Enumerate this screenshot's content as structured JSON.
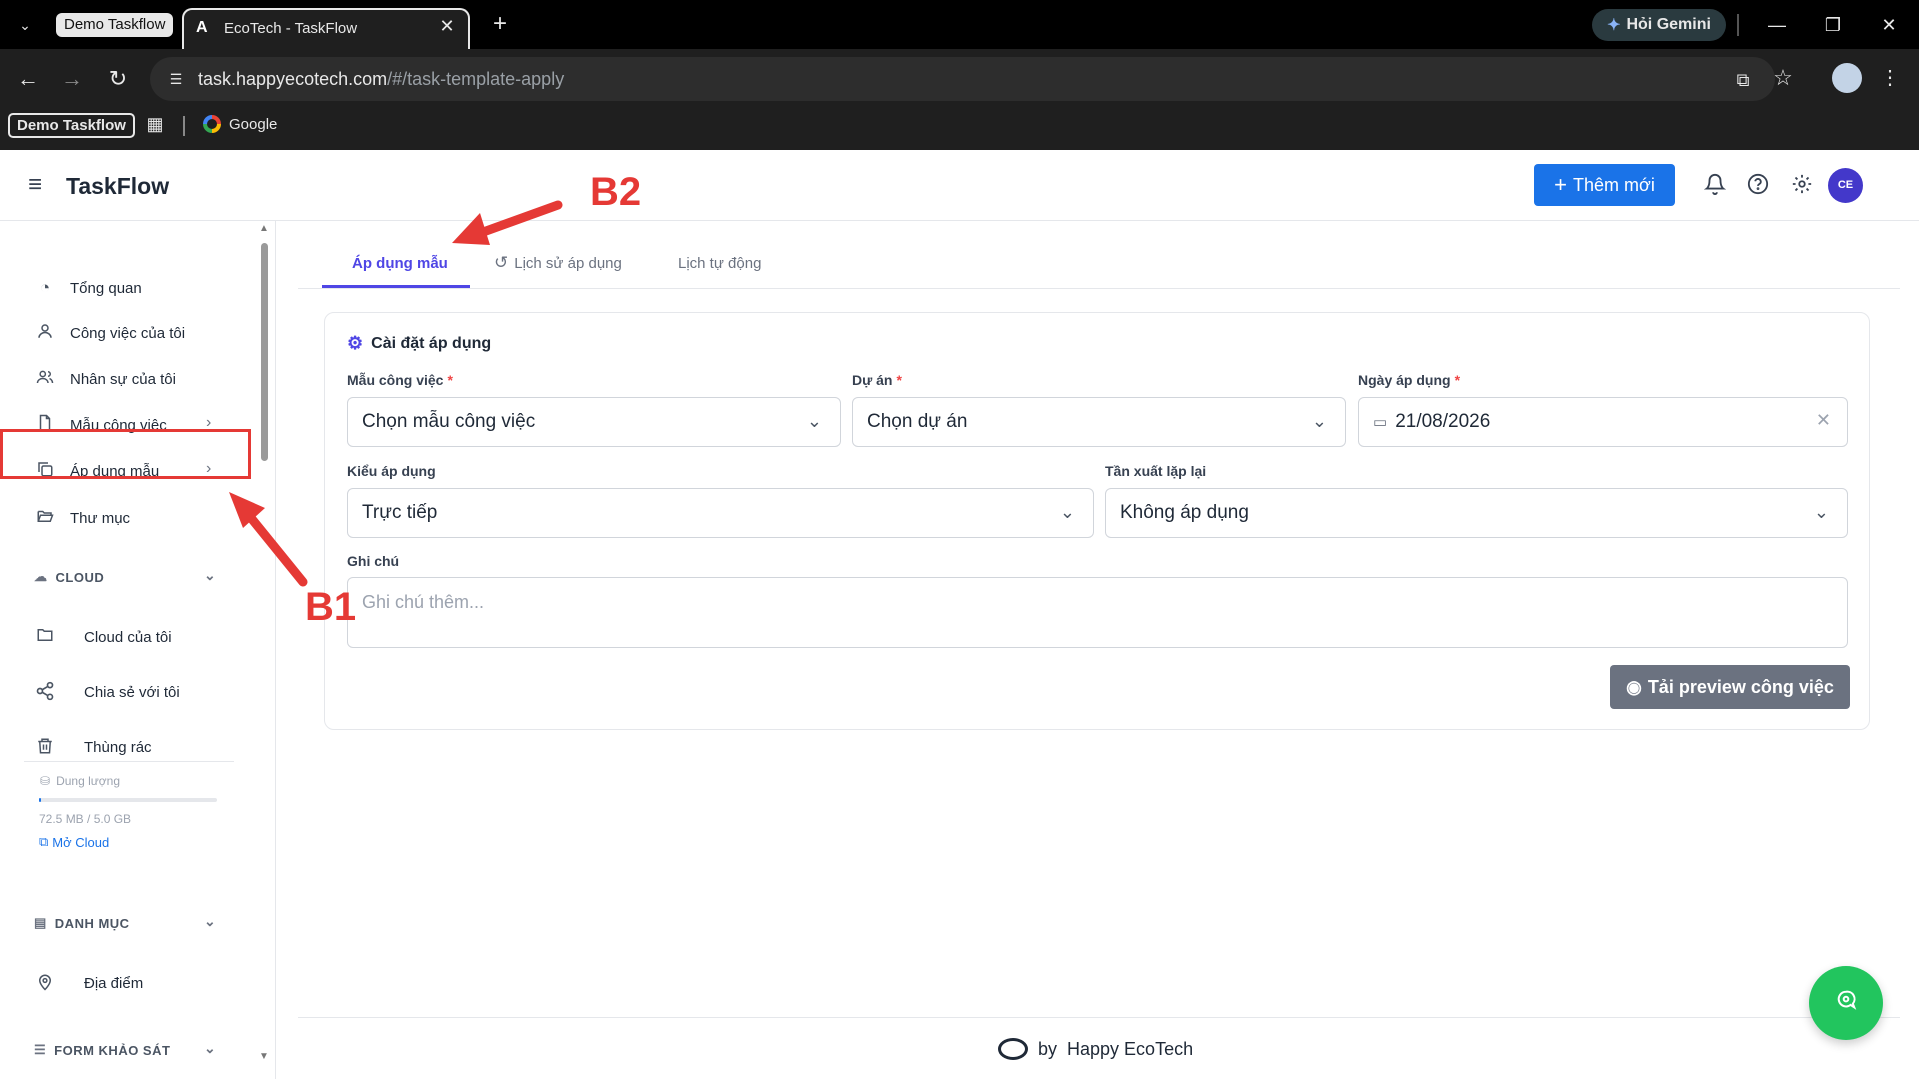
{
  "browser": {
    "tab_group": "Demo Taskflow",
    "active_tab_title": "EcoTech - TaskFlow",
    "tab_favicon": "A",
    "gemini_label": "Hỏi Gemini",
    "url_host": "task.happyecotech.com",
    "url_path": "/#/task-template-apply",
    "bookmarks": {
      "chip": "Demo Taskflow",
      "google": "Google"
    }
  },
  "header": {
    "app_title": "TaskFlow",
    "add_button": "Thêm mới",
    "avatar_initials": "CE"
  },
  "sidebar": {
    "items": [
      {
        "label": "Tổng quan",
        "icon": "clock-icon"
      },
      {
        "label": "Công việc của tôi",
        "icon": "user-icon"
      },
      {
        "label": "Nhân sự của tôi",
        "icon": "users-icon"
      },
      {
        "label": "Mẫu công việc",
        "icon": "file-icon"
      },
      {
        "label": "Áp dụng mẫu",
        "icon": "copy-icon"
      },
      {
        "label": "Thư mục",
        "icon": "folder-open-icon"
      }
    ],
    "cloud_section": "CLOUD",
    "cloud_items": [
      {
        "label": "Cloud của tôi"
      },
      {
        "label": "Chia sẻ với tôi"
      },
      {
        "label": "Thùng rác"
      }
    ],
    "storage": {
      "label": "Dung lượng",
      "usage": "72.5 MB / 5.0 GB",
      "used_fraction": 0.014,
      "link": "Mở Cloud"
    },
    "category_section": "DANH MỤC",
    "category_items": [
      {
        "label": "Địa điểm"
      }
    ],
    "survey_section": "FORM KHẢO SÁT"
  },
  "tabs": [
    {
      "label": "Áp dụng mẫu",
      "active": true
    },
    {
      "label": "Lịch sử áp dụng",
      "active": false
    },
    {
      "label": "Lịch tự động",
      "active": false
    }
  ],
  "form": {
    "title": "Cài đặt áp dụng",
    "template_label": "Mẫu công việc",
    "template_value": "Chọn mẫu công việc",
    "project_label": "Dự án",
    "project_value": "Chọn dự án",
    "date_label": "Ngày áp dụng",
    "date_value": "21/08/2026",
    "apply_type_label": "Kiểu áp dụng",
    "apply_type_value": "Trực tiếp",
    "repeat_label": "Tần xuất lặp lại",
    "repeat_value": "Không áp dụng",
    "note_label": "Ghi chú",
    "note_placeholder": "Ghi chú thêm...",
    "preview_button": "Tải preview công việc"
  },
  "footer": {
    "by": "by",
    "brand": "Happy EcoTech"
  },
  "annotations": {
    "b1": "B1",
    "b2": "B2"
  },
  "colors": {
    "primary": "#1a73e8",
    "accent": "#4f46e5",
    "annotation": "#e53935",
    "fab": "#22c55e"
  }
}
